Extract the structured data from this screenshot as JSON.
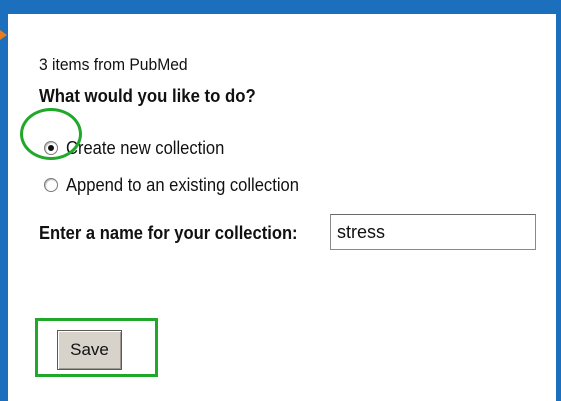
{
  "panel": {
    "border_color": "#1b6fbd",
    "corner_mark_color": "#e87d1e"
  },
  "summary": {
    "items_text": "3 items from PubMed",
    "question": "What would you like to do?"
  },
  "options": {
    "create_new": {
      "label": "Create new collection",
      "checked": true
    },
    "append_existing": {
      "label": "Append to an existing collection",
      "checked": false
    }
  },
  "collection_name": {
    "label": "Enter a name for your collection:",
    "value": "stress"
  },
  "actions": {
    "save_label": "Save"
  },
  "annotations": {
    "highlight_color": "#1fa82a",
    "highlights": [
      "create-new-radio",
      "save-button"
    ]
  }
}
